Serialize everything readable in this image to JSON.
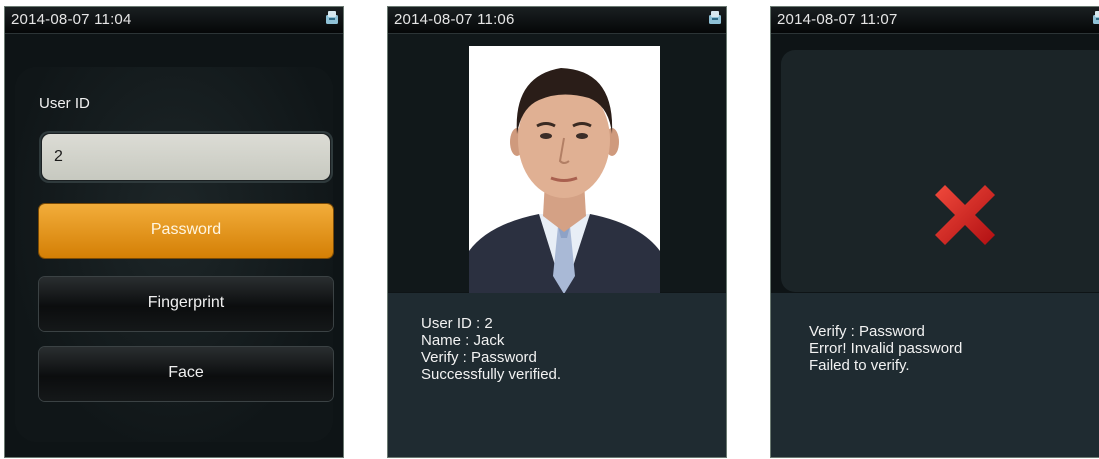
{
  "screens": [
    {
      "time": "2014-08-07 11:04",
      "user_id_label": "User ID",
      "user_id_value": "2",
      "buttons": {
        "password": "Password",
        "fingerprint": "Fingerprint",
        "face": "Face"
      }
    },
    {
      "time": "2014-08-07 11:06",
      "lines": [
        "User ID : 2",
        "Name : Jack",
        "Verify : Password",
        "Successfully verified."
      ]
    },
    {
      "time": "2014-08-07 11:07",
      "lines": [
        "Verify : Password",
        "Error! Invalid password",
        "Failed to verify."
      ]
    }
  ],
  "icons": {
    "status": "card-reader-icon",
    "fail": "red-x-icon"
  },
  "colors": {
    "accent_orange": "#e9960f",
    "fail_red": "#d81e1e",
    "screen_bg": "#0e1416",
    "info_bg": "#1f2b31"
  }
}
